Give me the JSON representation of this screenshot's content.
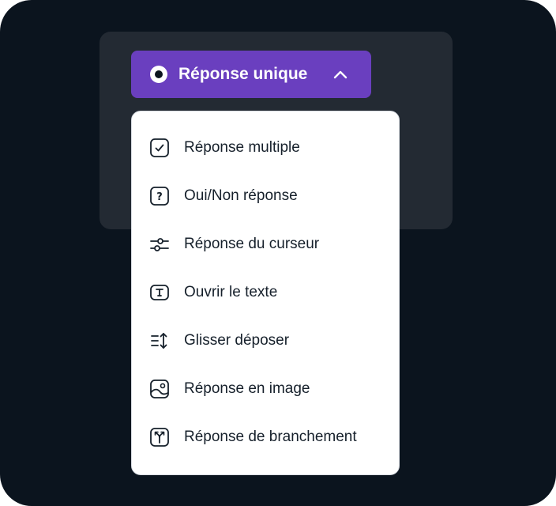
{
  "trigger": {
    "label": "Réponse unique",
    "icon": "radio-selected-icon",
    "accent": "#6a3fbf"
  },
  "menu": {
    "items": [
      {
        "label": "Réponse multiple",
        "icon": "checkbox-icon"
      },
      {
        "label": "Oui/Non réponse",
        "icon": "question-box-icon"
      },
      {
        "label": "Réponse du curseur",
        "icon": "sliders-icon"
      },
      {
        "label": "Ouvrir le texte",
        "icon": "text-box-icon"
      },
      {
        "label": "Glisser déposer",
        "icon": "reorder-icon"
      },
      {
        "label": "Réponse en image",
        "icon": "image-icon"
      },
      {
        "label": "Réponse de branchement",
        "icon": "branch-icon"
      }
    ]
  }
}
